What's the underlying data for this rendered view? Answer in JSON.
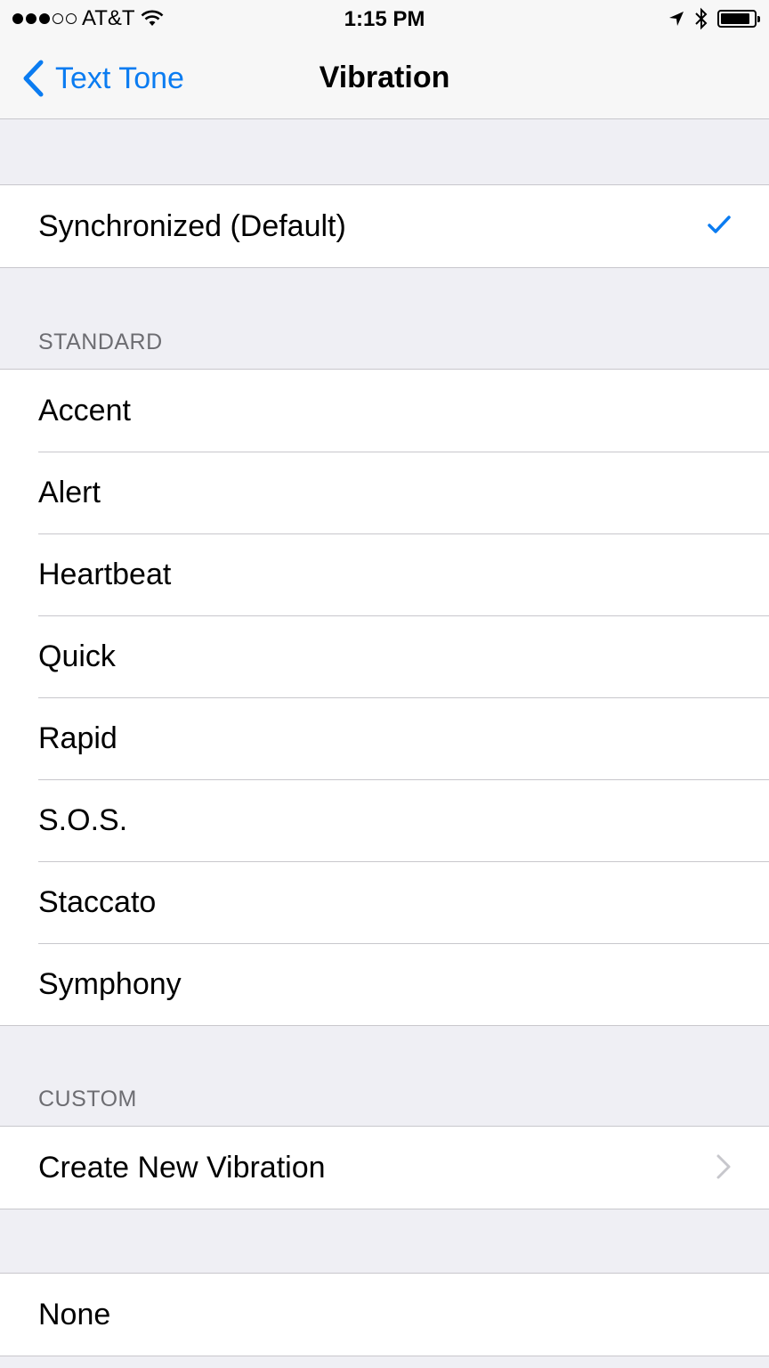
{
  "status_bar": {
    "carrier": "AT&T",
    "time": "1:15 PM"
  },
  "nav": {
    "back_label": "Text Tone",
    "title": "Vibration"
  },
  "default_option": {
    "label": "Synchronized (Default)",
    "selected": true
  },
  "standard": {
    "header": "STANDARD",
    "items": [
      "Accent",
      "Alert",
      "Heartbeat",
      "Quick",
      "Rapid",
      "S.O.S.",
      "Staccato",
      "Symphony"
    ]
  },
  "custom": {
    "header": "CUSTOM",
    "create_label": "Create New Vibration"
  },
  "none_option": {
    "label": "None"
  },
  "colors": {
    "accent": "#0b7cf1",
    "background": "#efeff4"
  }
}
